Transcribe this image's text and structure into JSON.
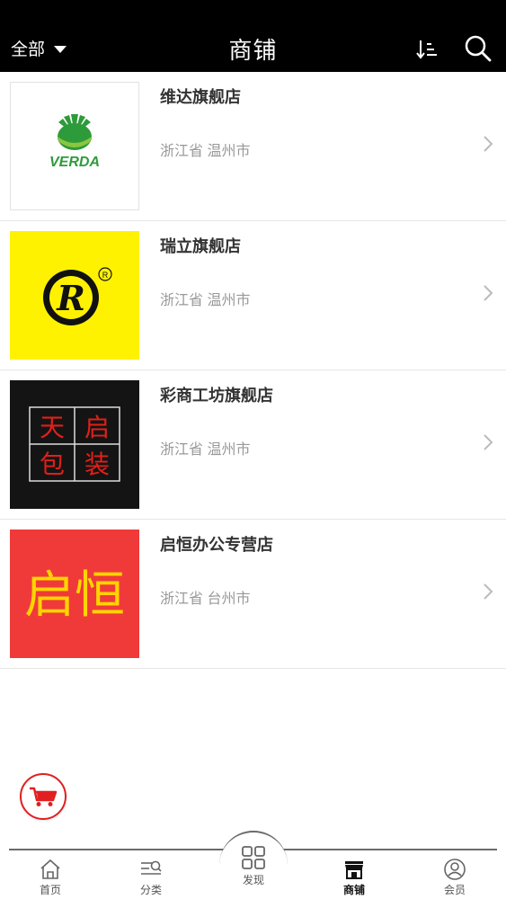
{
  "header": {
    "filter_label": "全部",
    "title": "商铺"
  },
  "shops": [
    {
      "name": "维达旗舰店",
      "location": "浙江省 温州市",
      "logo_text": "VERDA"
    },
    {
      "name": "瑞立旗舰店",
      "location": "浙江省 温州市",
      "logo_text": "R"
    },
    {
      "name": "彩商工坊旗舰店",
      "location": "浙江省 温州市",
      "logo_text": [
        "天",
        "启",
        "包",
        "装"
      ]
    },
    {
      "name": "启恒办公专营店",
      "location": "浙江省 台州市",
      "logo_text": "启恒"
    }
  ],
  "tabbar": {
    "home": "首页",
    "category": "分类",
    "discover": "发现",
    "shop": "商铺",
    "member": "会员",
    "active": "shop"
  },
  "colors": {
    "header_bg": "#000000",
    "accent_red": "#e02020",
    "ruili_yellow": "#fff200",
    "qiheng_red": "#f03a3a",
    "verda_green": "#2e9b3a"
  },
  "icons": {
    "sort": "sort-desc-icon",
    "search": "search-icon",
    "chevron": "chevron-right-icon",
    "cart": "cart-icon",
    "home": "home-icon",
    "category": "category-list-icon",
    "discover": "grid-icon",
    "shop": "storefront-icon",
    "member": "user-icon"
  }
}
